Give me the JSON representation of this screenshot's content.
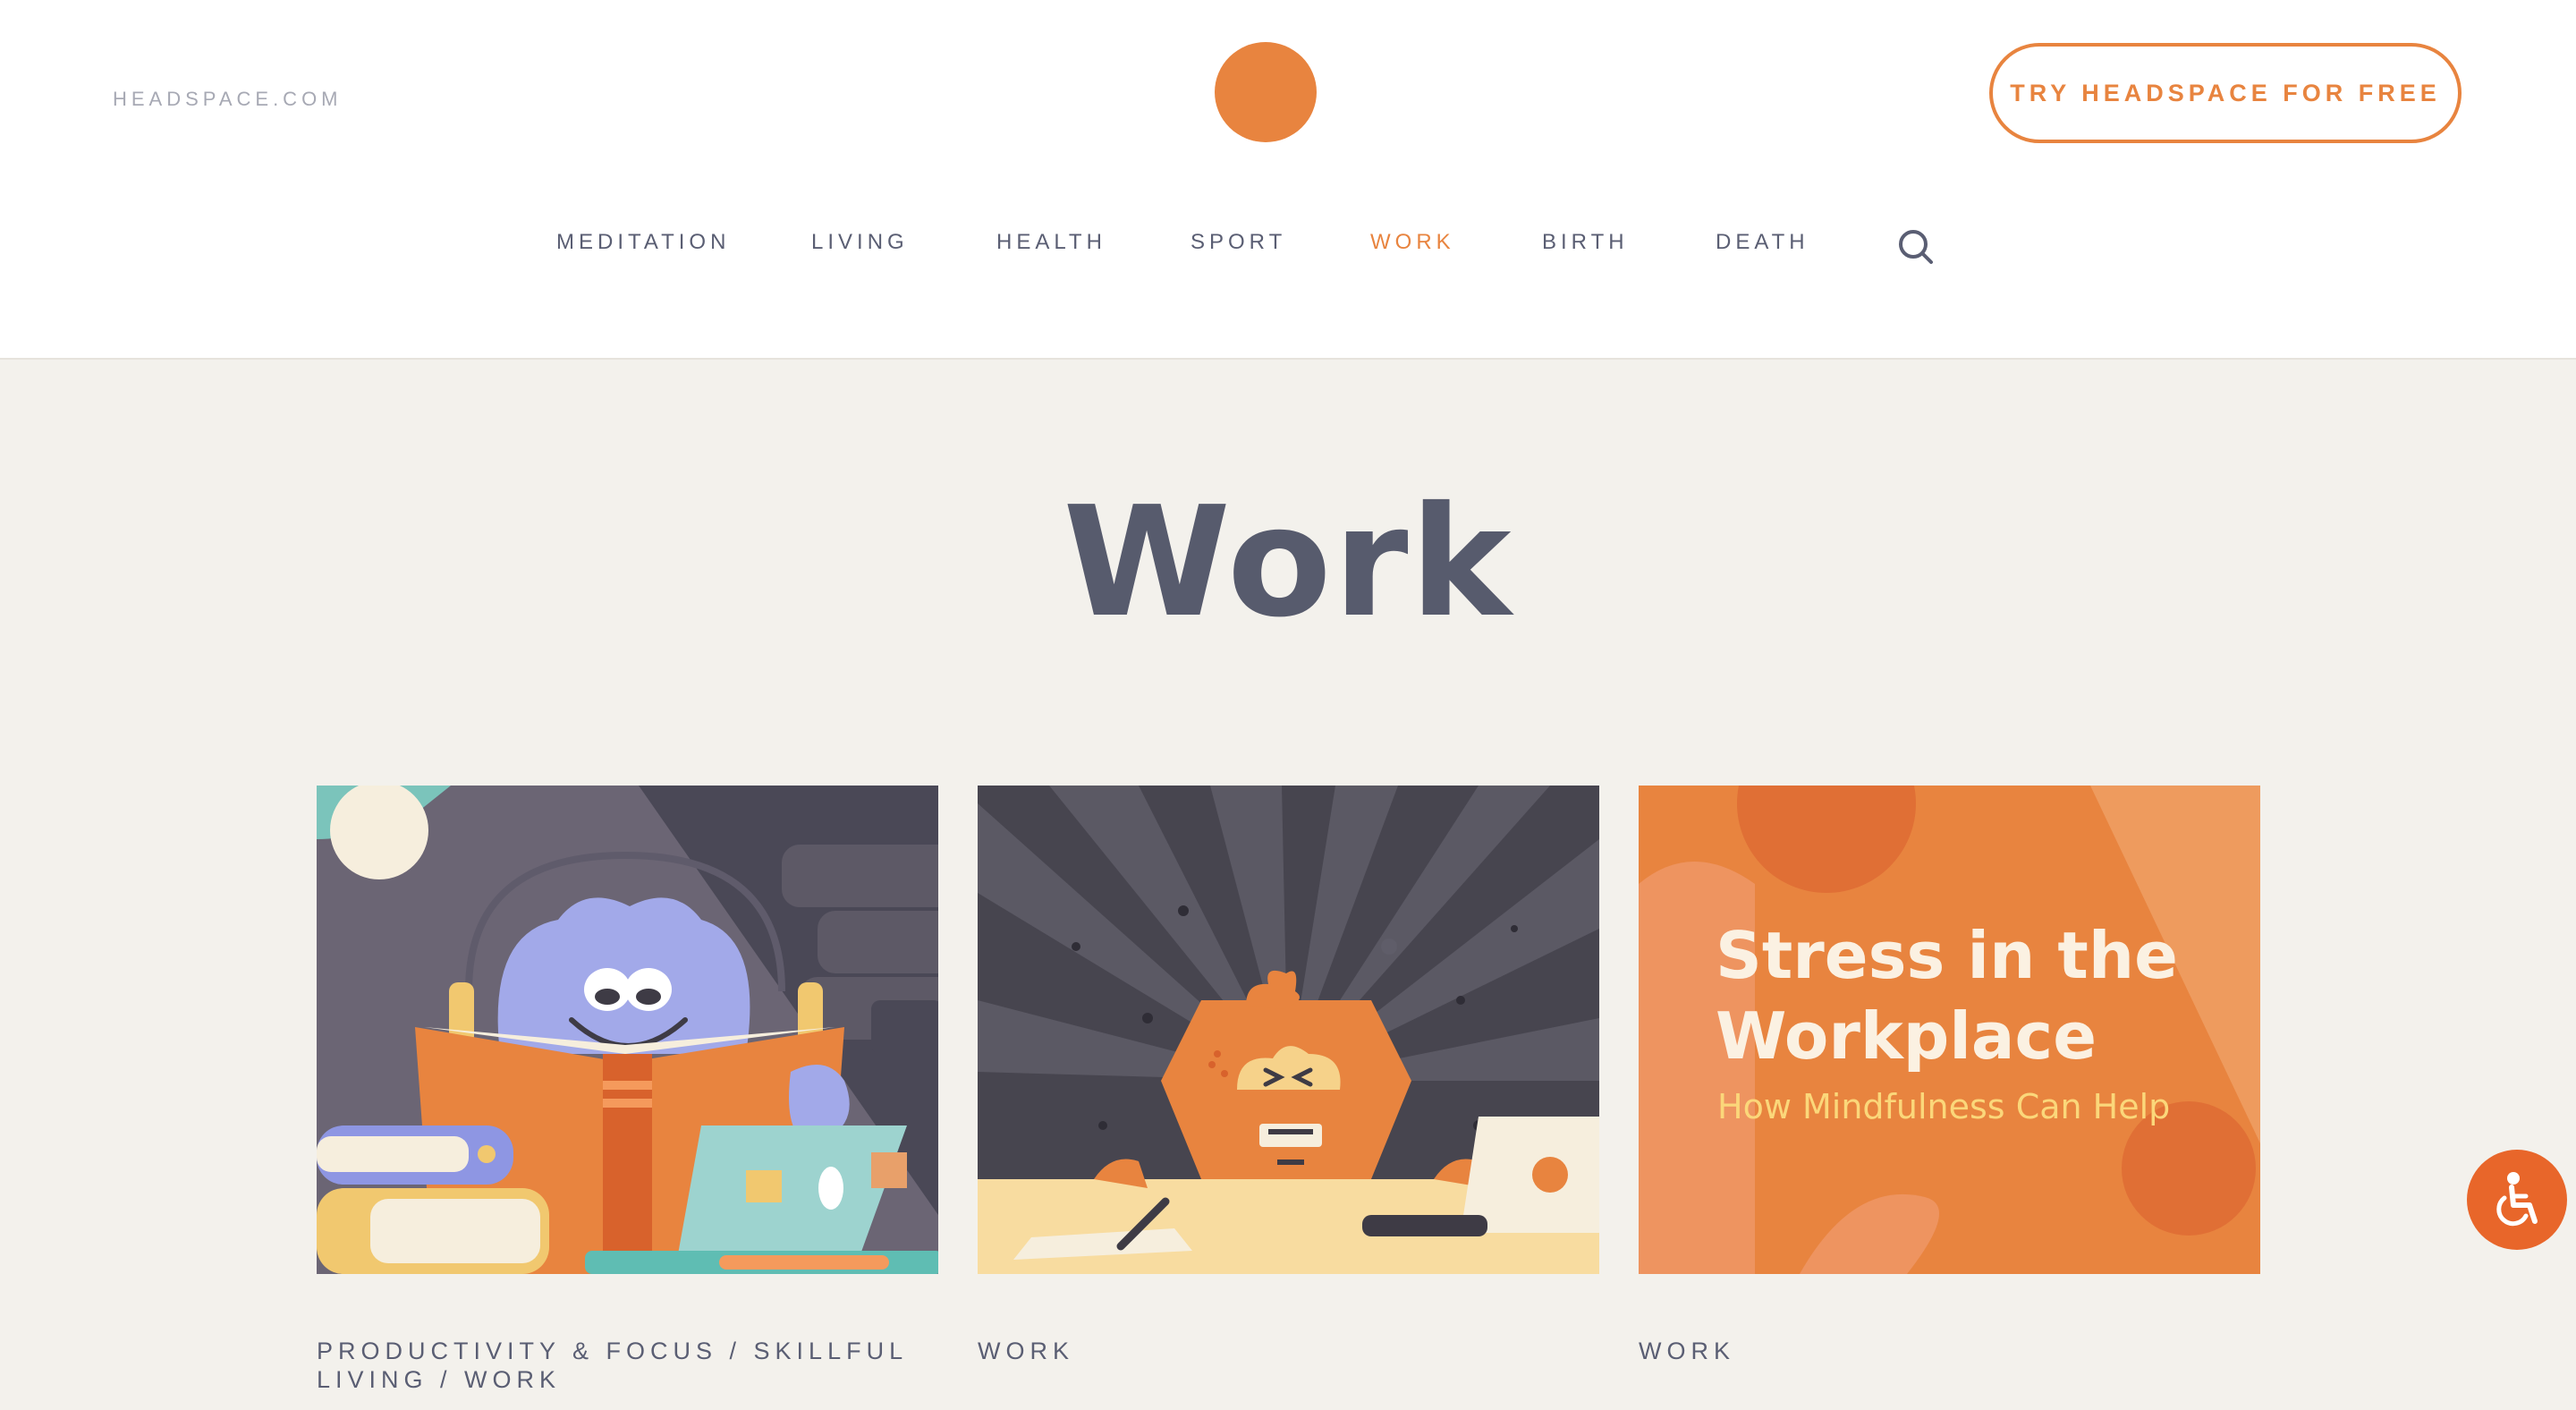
{
  "header": {
    "site_link": "HEADSPACE.COM",
    "cta_label": "TRY HEADSPACE FOR FREE",
    "brand_color": "#e8843f"
  },
  "nav": {
    "items": [
      {
        "label": "MEDITATION",
        "active": false
      },
      {
        "label": "LIVING",
        "active": false
      },
      {
        "label": "HEALTH",
        "active": false
      },
      {
        "label": "SPORT",
        "active": false
      },
      {
        "label": "WORK",
        "active": true
      },
      {
        "label": "BIRTH",
        "active": false
      },
      {
        "label": "DEATH",
        "active": false
      }
    ],
    "search_icon": "search-icon"
  },
  "page": {
    "title": "Work"
  },
  "cards": [
    {
      "image": "reading-character-illustration",
      "categories": "PRODUCTIVITY & FOCUS / SKILLFUL LIVING / WORK"
    },
    {
      "image": "stressed-character-at-desk-illustration",
      "categories": "WORK"
    },
    {
      "image": "stress-in-workplace-banner",
      "banner_title": "Stress in the Workplace",
      "banner_subtitle": "How Mindfulness Can Help",
      "categories": "WORK"
    }
  ],
  "accessibility_widget": {
    "icon": "wheelchair-icon",
    "color": "#e8662a"
  }
}
